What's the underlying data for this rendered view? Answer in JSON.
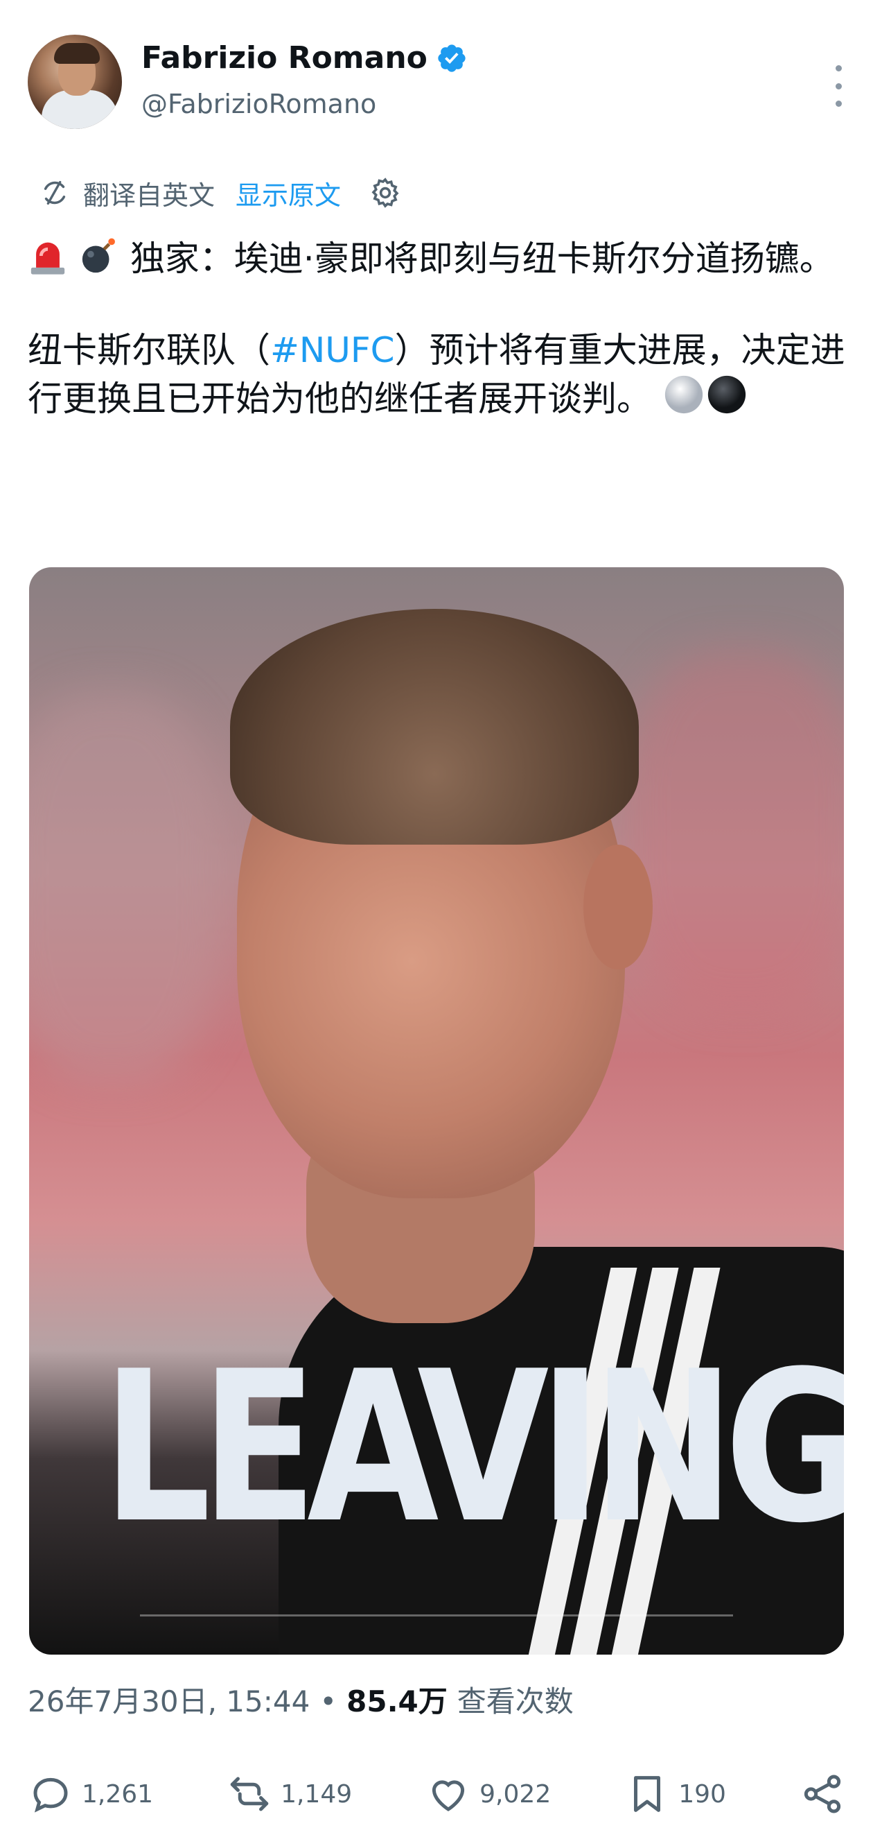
{
  "author": {
    "name": "Fabrizio Romano",
    "handle": "@FabrizioRomano",
    "verified": true
  },
  "translation": {
    "label": "翻译自英文",
    "show_original": "显示原文"
  },
  "tweet": {
    "line1": "独家：埃迪·豪即将即刻与纽卡斯尔分道扬镳。",
    "para2_before": "纽卡斯尔联队（",
    "hashtag": "#NUFC",
    "para2_after": "）预计将有重大进展，决定进行更换且已开始为他的继任者展开谈判。"
  },
  "media": {
    "overlay_text": "LEAVING"
  },
  "meta": {
    "datetime": "26年7月30日, 15:44",
    "separator": "•",
    "views": "85.4万",
    "views_label": "查看次数"
  },
  "actions": {
    "replies": "1,261",
    "retweets": "1,149",
    "likes": "9,022",
    "bookmarks": "190"
  },
  "colors": {
    "accent": "#1d9bf0",
    "secondary_text": "#536471",
    "primary_text": "#0f1419"
  }
}
